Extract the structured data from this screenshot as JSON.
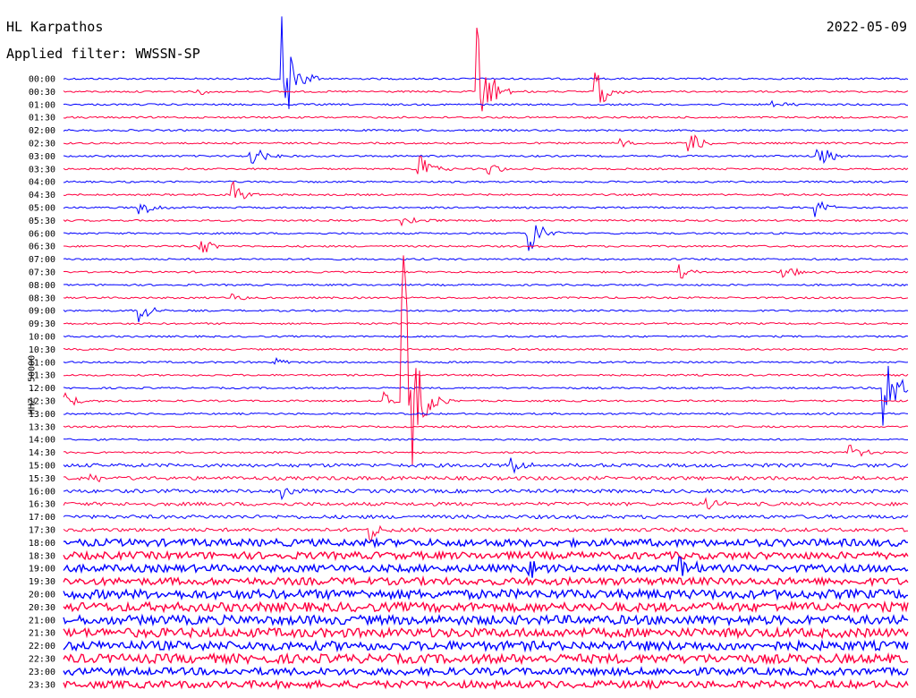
{
  "header": {
    "station": "HL Karpathos",
    "filter": "Applied filter: WWSSN-SP",
    "date": "2022-05-09"
  },
  "colors": {
    "odd": "#0000ff",
    "even": "#ff0040",
    "background": "#ffffff"
  },
  "chart_data": {
    "type": "line",
    "title": "HL Karpathos",
    "subtitle": "Applied filter: WWSSN-SP",
    "ylabel": "HHZ - 50000",
    "xlabel": "",
    "grid": false,
    "legend": "none",
    "y_tick_labels": [
      "00:00",
      "00:30",
      "01:00",
      "01:30",
      "02:00",
      "02:30",
      "03:00",
      "03:30",
      "04:00",
      "04:30",
      "05:00",
      "05:30",
      "06:00",
      "06:30",
      "07:00",
      "07:30",
      "08:00",
      "08:30",
      "09:00",
      "09:30",
      "10:00",
      "10:30",
      "11:00",
      "11:30",
      "12:00",
      "12:30",
      "13:00",
      "13:30",
      "14:00",
      "14:30",
      "15:00",
      "15:30",
      "16:00",
      "16:30",
      "17:00",
      "17:30",
      "18:00",
      "18:30",
      "19:00",
      "19:30",
      "20:00",
      "20:30",
      "21:00",
      "21:30",
      "22:00",
      "22:30",
      "23:00",
      "23:30"
    ],
    "noise_levels": [
      1,
      1,
      1,
      1,
      1,
      1,
      1,
      1,
      1,
      1,
      1,
      1,
      1,
      1,
      1,
      1,
      1,
      1,
      1,
      1,
      1,
      1,
      1,
      1,
      1,
      1,
      1,
      1,
      1,
      1,
      2,
      2,
      2,
      2,
      2,
      2,
      4,
      4,
      4,
      4,
      5,
      5,
      5,
      5,
      5,
      5,
      4,
      4
    ],
    "events": [
      {
        "row": 0,
        "x": 0.26,
        "amp": 70
      },
      {
        "row": 1,
        "x": 0.16,
        "amp": 4
      },
      {
        "row": 1,
        "x": 0.49,
        "amp": 72
      },
      {
        "row": 1,
        "x": 0.63,
        "amp": 25
      },
      {
        "row": 2,
        "x": 0.84,
        "amp": 6
      },
      {
        "row": 5,
        "x": 0.66,
        "amp": 6
      },
      {
        "row": 5,
        "x": 0.74,
        "amp": 16
      },
      {
        "row": 6,
        "x": 0.22,
        "amp": 18
      },
      {
        "row": 6,
        "x": 0.89,
        "amp": 22
      },
      {
        "row": 7,
        "x": 0.42,
        "amp": 20
      },
      {
        "row": 7,
        "x": 0.5,
        "amp": 10
      },
      {
        "row": 9,
        "x": 0.2,
        "amp": 18
      },
      {
        "row": 10,
        "x": 0.09,
        "amp": 14
      },
      {
        "row": 10,
        "x": 0.89,
        "amp": 14
      },
      {
        "row": 11,
        "x": 0.4,
        "amp": 10
      },
      {
        "row": 12,
        "x": 0.55,
        "amp": 30
      },
      {
        "row": 13,
        "x": 0.16,
        "amp": 14
      },
      {
        "row": 15,
        "x": 0.73,
        "amp": 8
      },
      {
        "row": 15,
        "x": 0.85,
        "amp": 12
      },
      {
        "row": 17,
        "x": 0.2,
        "amp": 6
      },
      {
        "row": 18,
        "x": 0.09,
        "amp": 16
      },
      {
        "row": 22,
        "x": 0.25,
        "amp": 6
      },
      {
        "row": 25,
        "x": 0.0,
        "amp": 14
      },
      {
        "row": 25,
        "x": 0.38,
        "amp": 14
      },
      {
        "row": 25,
        "x": 0.4,
        "amp": 210
      },
      {
        "row": 24,
        "x": 0.97,
        "amp": 60
      },
      {
        "row": 29,
        "x": 0.93,
        "amp": 14
      },
      {
        "row": 30,
        "x": 0.53,
        "amp": 10
      },
      {
        "row": 31,
        "x": 0.03,
        "amp": 8
      },
      {
        "row": 32,
        "x": 0.26,
        "amp": 8
      },
      {
        "row": 33,
        "x": 0.76,
        "amp": 8
      },
      {
        "row": 35,
        "x": 0.36,
        "amp": 16
      },
      {
        "row": 38,
        "x": 0.55,
        "amp": 12
      },
      {
        "row": 38,
        "x": 0.73,
        "amp": 14
      }
    ]
  }
}
